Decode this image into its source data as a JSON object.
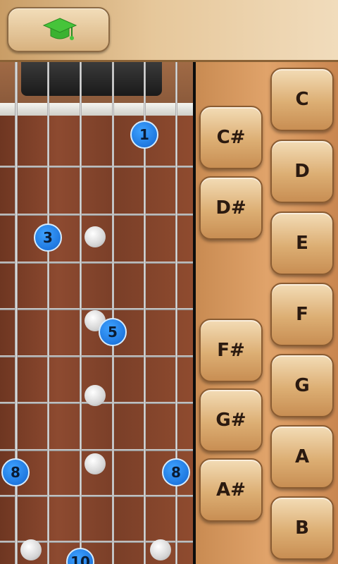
{
  "topbar": {
    "learn_icon": "graduation-cap-icon",
    "accent": "#46c43a"
  },
  "fretboard": {
    "finger_markers": [
      {
        "label": "1",
        "string": 5,
        "fret": 1
      },
      {
        "label": "3",
        "string": 2,
        "fret": 3
      },
      {
        "label": "5",
        "string": 4,
        "fret": 5
      },
      {
        "label": "8",
        "string": 1,
        "fret": 8
      },
      {
        "label": "8",
        "string": 6,
        "fret": 8
      },
      {
        "label": "10",
        "string": 3,
        "fret": 10
      }
    ],
    "marker_color": "#1f78e0"
  },
  "keys": {
    "natural": [
      "C",
      "D",
      "E",
      "F",
      "G",
      "A",
      "B"
    ],
    "sharp": [
      "C#",
      "D#",
      "F#",
      "G#",
      "A#"
    ]
  }
}
